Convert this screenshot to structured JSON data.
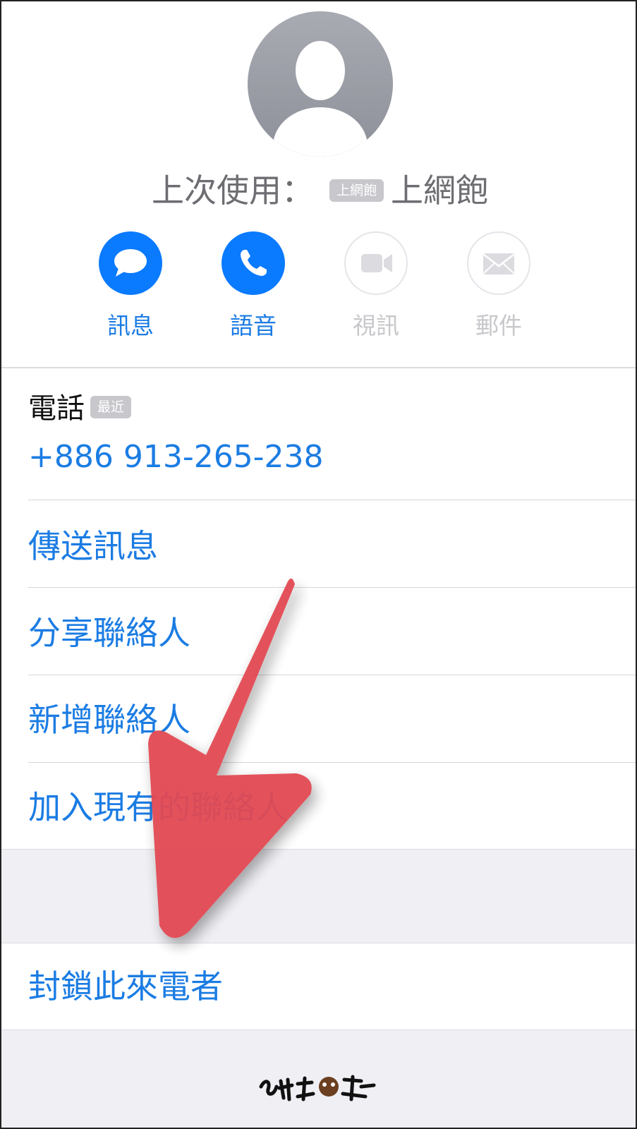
{
  "header": {
    "last_used_prefix": "上次使用：",
    "last_used_tag": "上網飽",
    "last_used_value": "上網飽"
  },
  "actions": [
    {
      "label": "訊息",
      "icon": "message-bubble-icon",
      "state": "active"
    },
    {
      "label": "語音",
      "icon": "phone-icon",
      "state": "active"
    },
    {
      "label": "視訊",
      "icon": "video-camera-icon",
      "state": "disabled"
    },
    {
      "label": "郵件",
      "icon": "mail-envelope-icon",
      "state": "disabled"
    }
  ],
  "phone": {
    "label": "電話",
    "tag": "最近",
    "number": "+886 913-265-238"
  },
  "options": [
    {
      "label": "傳送訊息"
    },
    {
      "label": "分享聯絡人"
    },
    {
      "label": "新增聯絡人"
    },
    {
      "label": "加入現有的聯絡人"
    }
  ],
  "block": {
    "label": "封鎖此來電者"
  },
  "colors": {
    "accent": "#0a7aff",
    "link_text": "#1b7ce3",
    "disabled": "#c8c8cc",
    "grouped_background": "#efeff4",
    "annotation_arrow": "#e24a52"
  }
}
